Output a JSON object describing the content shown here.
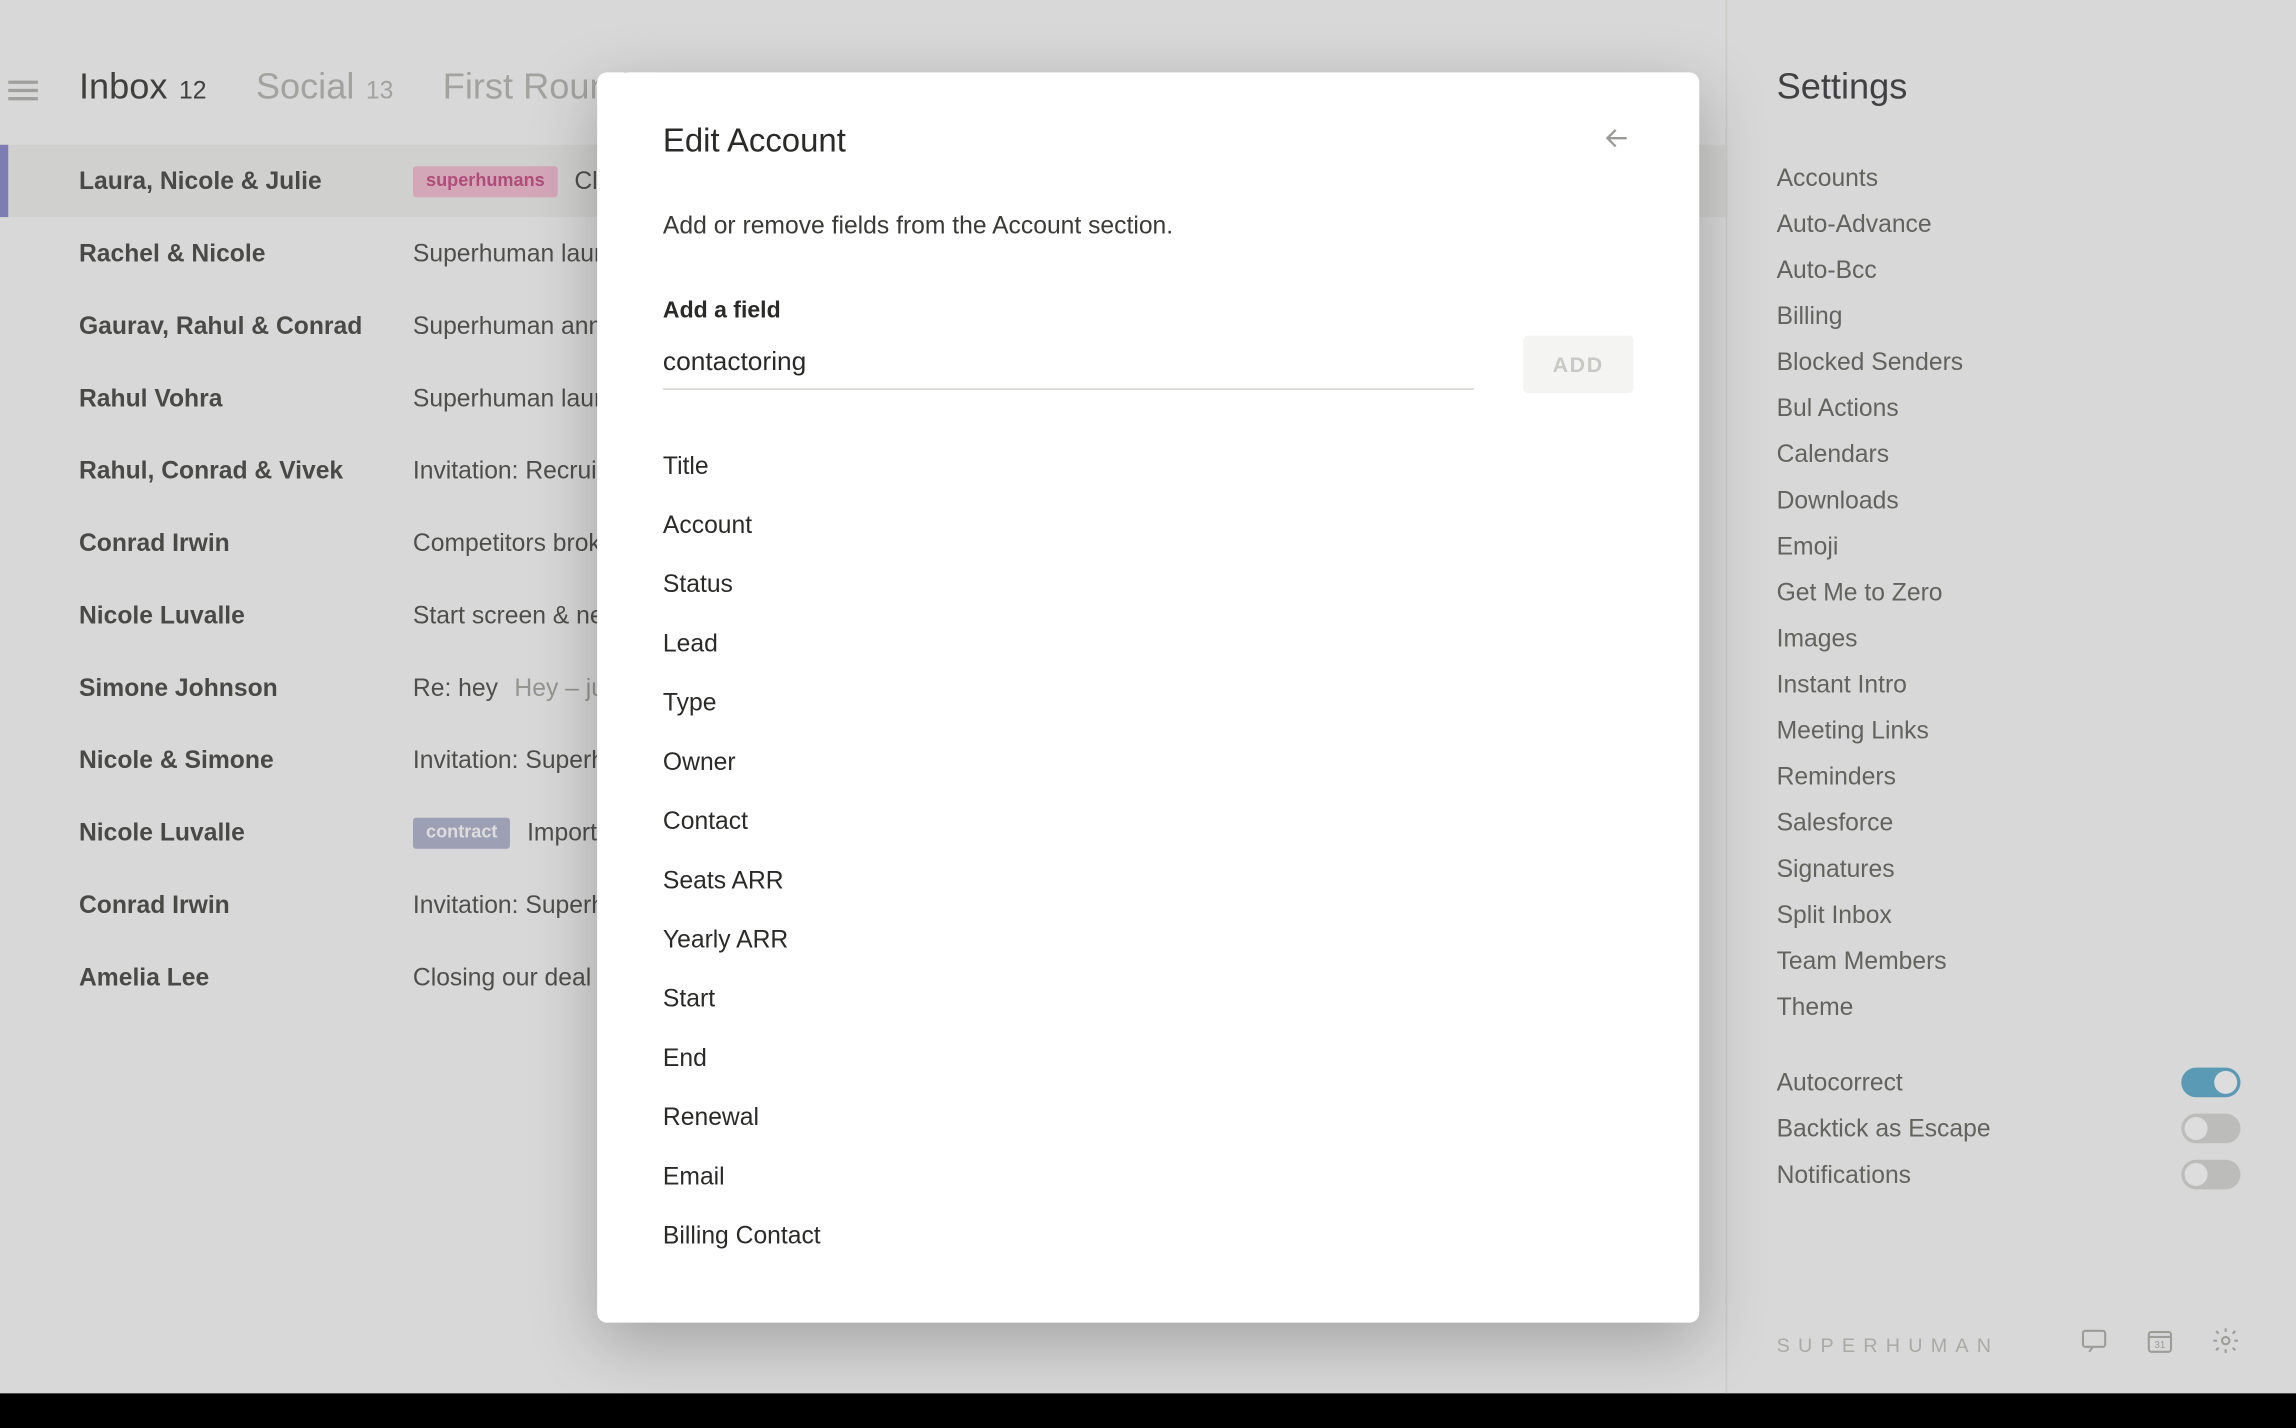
{
  "tabs": [
    {
      "label": "Inbox",
      "count": "12",
      "active": true
    },
    {
      "label": "Social",
      "count": "13",
      "active": false
    },
    {
      "label": "First Round",
      "count": "",
      "active": false
    }
  ],
  "threads": [
    {
      "from": "Laura, Nicole & Julie",
      "pill": "superhumans",
      "pill_class": "superhumans",
      "subject": "Clo",
      "preview": "",
      "selected": true
    },
    {
      "from": "Rachel & Nicole",
      "pill": "",
      "pill_class": "",
      "subject": "Superhuman laur",
      "preview": ""
    },
    {
      "from": "Gaurav, Rahul & Conrad",
      "pill": "",
      "pill_class": "",
      "subject": "Superhuman ann",
      "preview": ""
    },
    {
      "from": "Rahul Vohra",
      "pill": "",
      "pill_class": "",
      "subject": "Superhuman laur",
      "preview": ""
    },
    {
      "from": "Rahul, Conrad & Vivek",
      "pill": "",
      "pill_class": "",
      "subject": "Invitation: Recrui",
      "preview": ""
    },
    {
      "from": "Conrad Irwin",
      "pill": "",
      "pill_class": "",
      "subject": "Competitors brok",
      "preview": ""
    },
    {
      "from": "Nicole Luvalle",
      "pill": "",
      "pill_class": "",
      "subject": "Start screen & ne",
      "preview": ""
    },
    {
      "from": "Simone Johnson",
      "pill": "",
      "pill_class": "",
      "subject": "Re: hey",
      "preview": "Hey – ju"
    },
    {
      "from": "Nicole & Simone",
      "pill": "",
      "pill_class": "",
      "subject": "Invitation: Superh",
      "preview": ""
    },
    {
      "from": "Nicole Luvalle",
      "pill": "contract",
      "pill_class": "contract",
      "subject": "Import",
      "preview": ""
    },
    {
      "from": "Conrad Irwin",
      "pill": "",
      "pill_class": "",
      "subject": "Invitation: Superh",
      "preview": ""
    },
    {
      "from": "Amelia Lee",
      "pill": "",
      "pill_class": "",
      "subject": "Closing our deal",
      "preview": ""
    }
  ],
  "settings": {
    "title": "Settings",
    "items": [
      "Accounts",
      "Auto-Advance",
      "Auto-Bcc",
      "Billing",
      "Blocked Senders",
      "Bul Actions",
      "Calendars",
      "Downloads",
      "Emoji",
      "Get Me to Zero",
      "Images",
      "Instant Intro",
      "Meeting Links",
      "Reminders",
      "Salesforce",
      "Signatures",
      "Split Inbox",
      "Team Members",
      "Theme"
    ],
    "toggles": [
      {
        "label": "Autocorrect",
        "on": true
      },
      {
        "label": "Backtick as Escape",
        "on": false
      },
      {
        "label": "Notifications",
        "on": false
      }
    ],
    "brand": "SUPERHUMAN"
  },
  "modal": {
    "title": "Edit Account",
    "description": "Add or remove fields from the Account section.",
    "add_label": "Add a field",
    "input_value": "contactoring",
    "add_button": "ADD",
    "fields": [
      "Title",
      "Account",
      "Status",
      "Lead",
      "Type",
      "Owner",
      "Contact",
      "Seats ARR",
      "Yearly ARR",
      "Start",
      "End",
      "Renewal",
      "Email",
      "Billing Contact"
    ]
  }
}
